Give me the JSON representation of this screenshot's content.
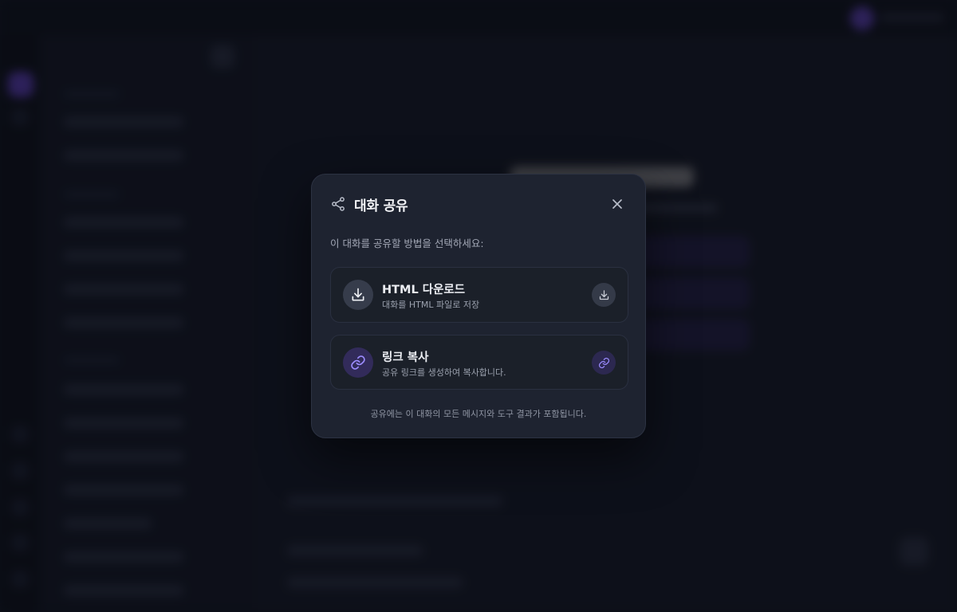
{
  "dialog": {
    "title": "대화 공유",
    "description": "이 대화를 공유할 방법을 선택하세요:",
    "footer_note": "공유에는 이 대화의 모든 메시지와 도구 결과가 포함됩니다."
  },
  "options": [
    {
      "title": "HTML 다운로드",
      "subtitle": "대화를 HTML 파일로 저장",
      "icon": "download-icon"
    },
    {
      "title": "링크 복사",
      "subtitle": "공유 링크를 생성하여 복사합니다.",
      "icon": "link-icon"
    }
  ],
  "colors": {
    "accent": "#7c6cf0",
    "modal_bg": "#1e2330",
    "overlay": "rgba(8, 10, 16, 0.55)"
  }
}
